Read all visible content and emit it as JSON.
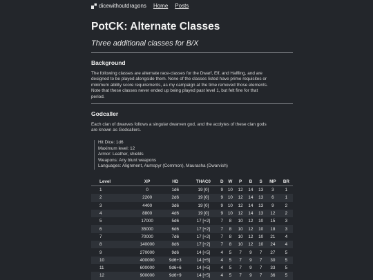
{
  "nav": {
    "site_name": "dicewithoutdragons",
    "links": [
      {
        "label": "Home"
      },
      {
        "label": "Posts"
      }
    ]
  },
  "page": {
    "title": "PotCK: Alternate Classes",
    "subtitle": "Three additional classes for B/X"
  },
  "sections": {
    "background": {
      "heading": "Background",
      "lines": [
        "The following classes are alternate race-classes for the Dwarf, Elf, and Halfling, and are",
        "designed to be played alongside them. None of the classes listed have prime requisites or",
        "minimum ability score requirements, as my campaign at the time removed those elements.",
        "Note that these classes never ended up being played past level 1, but felt fine for that",
        "period."
      ]
    },
    "godcaller": {
      "heading": "Godcaller",
      "lines": [
        "Each clan of dwarves follows a singular dwarven god, and the acolytes of these clan gods",
        "are known as Godcallers."
      ],
      "stats": [
        "Hit Dice: 1d6",
        "Maximum level: 12",
        "Armor: Leather, shields",
        "Weapons: Any blunt weapons",
        "Languages: Alignment, Aumspyr (Common), Maurasha (Dwarvish)"
      ]
    }
  },
  "table": {
    "headers": [
      "Level",
      "XP",
      "HD",
      "THAC0",
      "D",
      "W",
      "P",
      "B",
      "S",
      "MP",
      "BR"
    ],
    "rows": [
      [
        "1",
        "0",
        "1d6",
        "19 [0]",
        "9",
        "10",
        "12",
        "14",
        "13",
        "3",
        "1"
      ],
      [
        "2",
        "2200",
        "2d6",
        "19 [0]",
        "9",
        "10",
        "12",
        "14",
        "13",
        "6",
        "1"
      ],
      [
        "3",
        "4400",
        "3d6",
        "19 [0]",
        "9",
        "10",
        "12",
        "14",
        "13",
        "9",
        "2"
      ],
      [
        "4",
        "8800",
        "4d6",
        "19 [0]",
        "9",
        "10",
        "12",
        "14",
        "13",
        "12",
        "2"
      ],
      [
        "5",
        "17000",
        "5d6",
        "17 [+2]",
        "7",
        "8",
        "10",
        "12",
        "10",
        "15",
        "3"
      ],
      [
        "6",
        "35000",
        "6d6",
        "17 [+2]",
        "7",
        "8",
        "10",
        "12",
        "10",
        "18",
        "3"
      ],
      [
        "7",
        "70000",
        "7d6",
        "17 [+2]",
        "7",
        "8",
        "10",
        "12",
        "10",
        "21",
        "4"
      ],
      [
        "8",
        "140000",
        "8d6",
        "17 [+2]",
        "7",
        "8",
        "10",
        "12",
        "10",
        "24",
        "4"
      ],
      [
        "9",
        "270000",
        "9d6",
        "14 [+5]",
        "4",
        "5",
        "7",
        "9",
        "7",
        "27",
        "5"
      ],
      [
        "10",
        "400000",
        "9d6+3",
        "14 [+5]",
        "4",
        "5",
        "7",
        "9",
        "7",
        "30",
        "5"
      ],
      [
        "11",
        "600000",
        "9d6+6",
        "14 [+5]",
        "4",
        "5",
        "7",
        "9",
        "7",
        "33",
        "5"
      ],
      [
        "12",
        "900000",
        "9d6+9",
        "14 [+5]",
        "4",
        "5",
        "7",
        "9",
        "7",
        "36",
        "5"
      ]
    ]
  }
}
